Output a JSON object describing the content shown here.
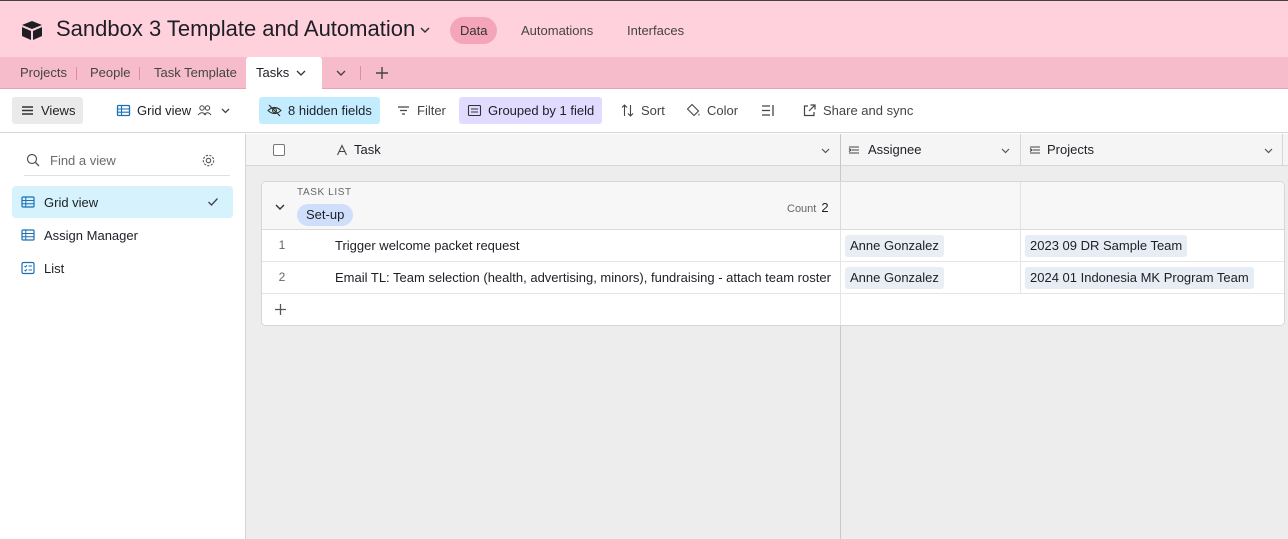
{
  "header": {
    "base_title": "Sandbox 3 Template and Automation",
    "nav": {
      "data": "Data",
      "automations": "Automations",
      "interfaces": "Interfaces"
    }
  },
  "tables": {
    "tabs": [
      {
        "label": "Projects"
      },
      {
        "label": "People"
      },
      {
        "label": "Task Template"
      },
      {
        "label": "Tasks"
      }
    ]
  },
  "toolbar": {
    "views": "Views",
    "view_name": "Grid view",
    "hidden_fields": "8 hidden fields",
    "filter": "Filter",
    "grouped": "Grouped by 1 field",
    "sort": "Sort",
    "color": "Color",
    "share": "Share and sync"
  },
  "sidebar": {
    "search_placeholder": "Find a view",
    "views": [
      {
        "label": "Grid view"
      },
      {
        "label": "Assign Manager"
      },
      {
        "label": "List"
      }
    ]
  },
  "grid": {
    "columns": {
      "task": "Task",
      "assignee": "Assignee",
      "projects": "Projects"
    },
    "group": {
      "field_label": "TASK LIST",
      "value": "Set-up",
      "count_label": "Count",
      "count": "2"
    },
    "rows": [
      {
        "num": "1",
        "task": "Trigger welcome packet request",
        "assignee": "Anne Gonzalez",
        "project": "2023 09 DR Sample Team"
      },
      {
        "num": "2",
        "task": "Email TL: Team selection (health, advertising, minors), fundraising - attach team roster",
        "assignee": "Anne Gonzalez",
        "project": "2024 01 Indonesia MK Program Team"
      }
    ]
  }
}
